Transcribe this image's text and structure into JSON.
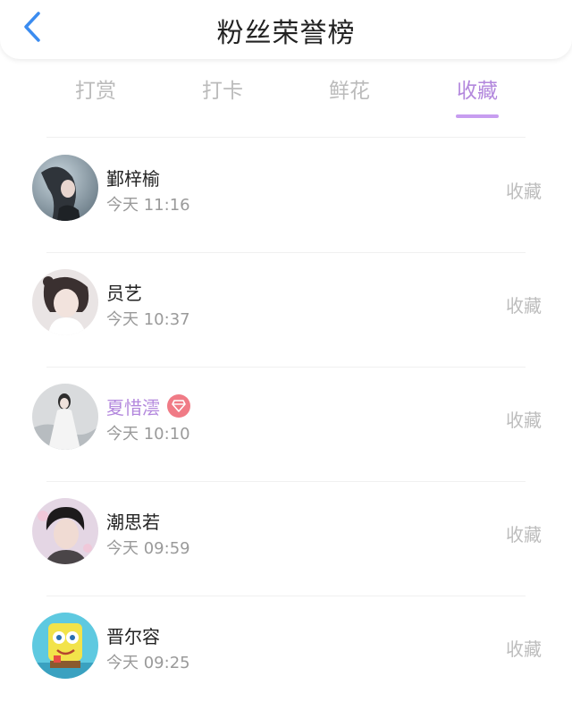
{
  "header": {
    "title": "粉丝荣誉榜",
    "back_icon": "chevron-left-icon",
    "accent_color": "#3b8cf0"
  },
  "tabs": [
    {
      "label": "打赏",
      "active": false
    },
    {
      "label": "打卡",
      "active": false
    },
    {
      "label": "鲜花",
      "active": false
    },
    {
      "label": "收藏",
      "active": true
    }
  ],
  "active_color": "#b388dd",
  "list": [
    {
      "name": "鄞梓榆",
      "time": "今天 11:16",
      "action": "收藏",
      "vip": false
    },
    {
      "name": "员艺",
      "time": "今天 10:37",
      "action": "收藏",
      "vip": false
    },
    {
      "name": "夏惜澐",
      "time": "今天 10:10",
      "action": "收藏",
      "vip": true
    },
    {
      "name": "潮思若",
      "time": "今天 09:59",
      "action": "收藏",
      "vip": false
    },
    {
      "name": "晋尔容",
      "time": "今天 09:25",
      "action": "收藏",
      "vip": false
    }
  ]
}
